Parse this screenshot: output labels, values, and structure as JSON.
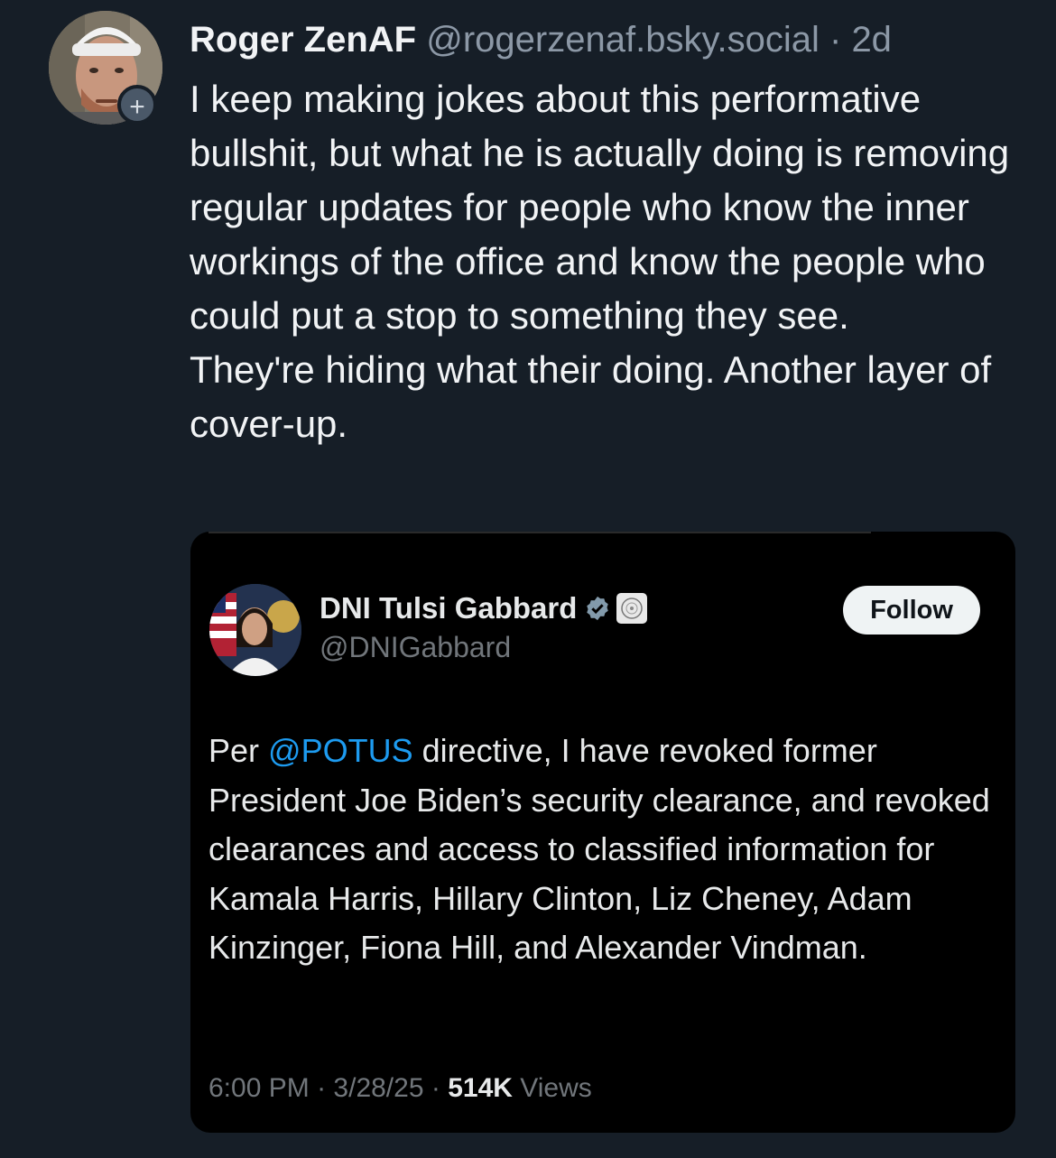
{
  "post": {
    "display_name": "Roger ZenAF",
    "handle": "@rogerzenaf.bsky.social",
    "separator": "·",
    "time": "2d",
    "follow_icon": "+",
    "text_lines": [
      "I keep making jokes about this performative bullshit, but what he is actually doing is removing regular updates for people who know the inner workings of the office and know the people who could put a stop to something they see.",
      "They're hiding what their doing. Another layer of cover-up."
    ]
  },
  "embed": {
    "name": "DNI Tulsi Gabbard",
    "handle": "@DNIGabbard",
    "follow_label": "Follow",
    "verified_icon": "verified-badge-icon",
    "affiliation_icon": "government-seal-icon",
    "text_prefix": "Per ",
    "mention": "@POTUS",
    "text_rest": " directive, I have revoked former President Joe Biden’s security clearance, and revoked clearances and access to classified information for Kamala Harris, Hillary Clinton, Liz Cheney, Adam Kinzinger, Fiona Hill, and Alexander Vindman.",
    "time": "6:00 PM",
    "sep1": "·",
    "date": "3/28/25",
    "sep2": "·",
    "views_count": "514K",
    "views_label": "Views",
    "colors": {
      "mention": "#1d9bf0",
      "verified": "#829aab"
    }
  }
}
